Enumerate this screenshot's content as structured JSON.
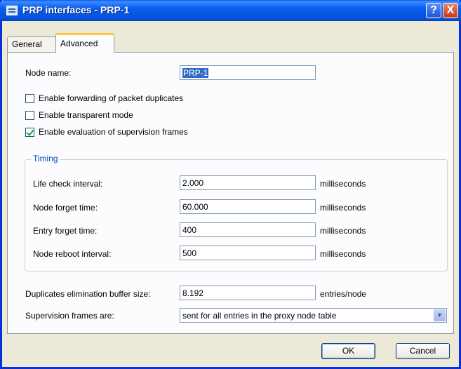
{
  "window": {
    "title": "PRP interfaces - PRP-1",
    "help_glyph": "?",
    "close_glyph": "X"
  },
  "tabs": [
    {
      "label": "General",
      "active": false
    },
    {
      "label": "Advanced",
      "active": true
    }
  ],
  "form": {
    "node_name_label": "Node name:",
    "node_name_value": "PRP-1",
    "checkboxes": [
      {
        "label": "Enable forwarding of packet duplicates",
        "checked": false
      },
      {
        "label": "Enable transparent mode",
        "checked": false
      },
      {
        "label": "Enable evaluation of supervision frames",
        "checked": true
      }
    ],
    "timing": {
      "title": "Timing",
      "rows": [
        {
          "label": "Life check interval:",
          "value": "2.000",
          "unit": "milliseconds"
        },
        {
          "label": "Node forget time:",
          "value": "60.000",
          "unit": "milliseconds"
        },
        {
          "label": "Entry forget time:",
          "value": "400",
          "unit": "milliseconds"
        },
        {
          "label": "Node reboot interval:",
          "value": "500",
          "unit": "milliseconds"
        }
      ]
    },
    "buffer_label": "Duplicates elimination buffer size:",
    "buffer_value": "8.192",
    "buffer_unit": "entries/node",
    "supervision_label": "Supervision frames are:",
    "supervision_value": "sent for all entries in the proxy node table"
  },
  "buttons": {
    "ok": "OK",
    "cancel": "Cancel"
  }
}
